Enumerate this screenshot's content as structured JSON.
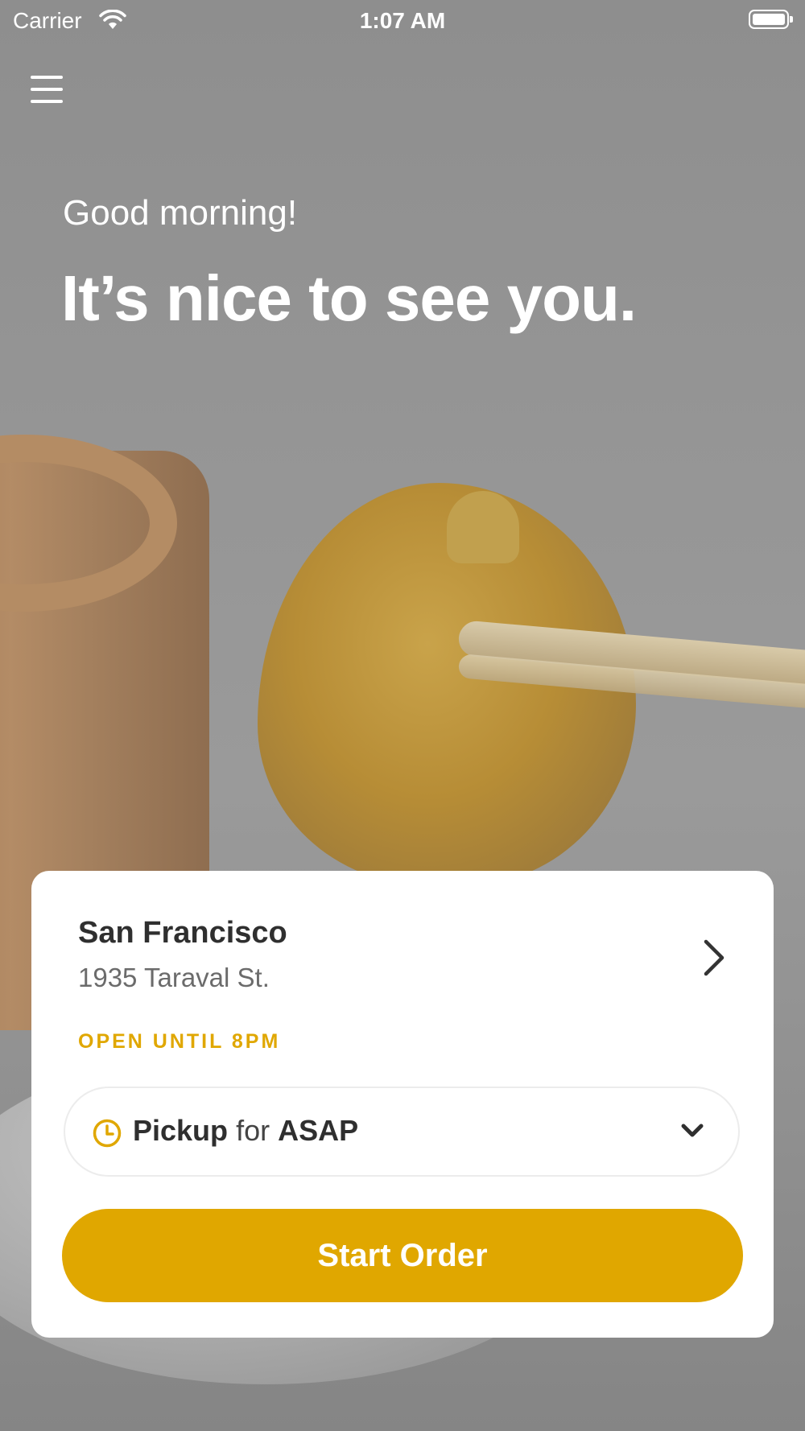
{
  "status_bar": {
    "carrier": "Carrier",
    "time": "1:07 AM"
  },
  "hero": {
    "greeting": "Good morning!",
    "headline": "It’s nice to see you."
  },
  "card": {
    "city": "San Francisco",
    "address": "1935 Taraval St.",
    "hours": "OPEN UNTIL 8PM",
    "order_mode": {
      "method": "Pickup",
      "connector": "for",
      "time": "ASAP"
    },
    "start_button_label": "Start Order"
  },
  "colors": {
    "accent": "#E0A700",
    "card_background": "#FFFFFF",
    "text_primary": "#2F2F2F",
    "text_secondary": "#6B6B6B"
  },
  "icons": [
    "menu-icon",
    "wifi-icon",
    "battery-icon",
    "chevron-right-icon",
    "clock-icon",
    "chevron-down-icon"
  ]
}
